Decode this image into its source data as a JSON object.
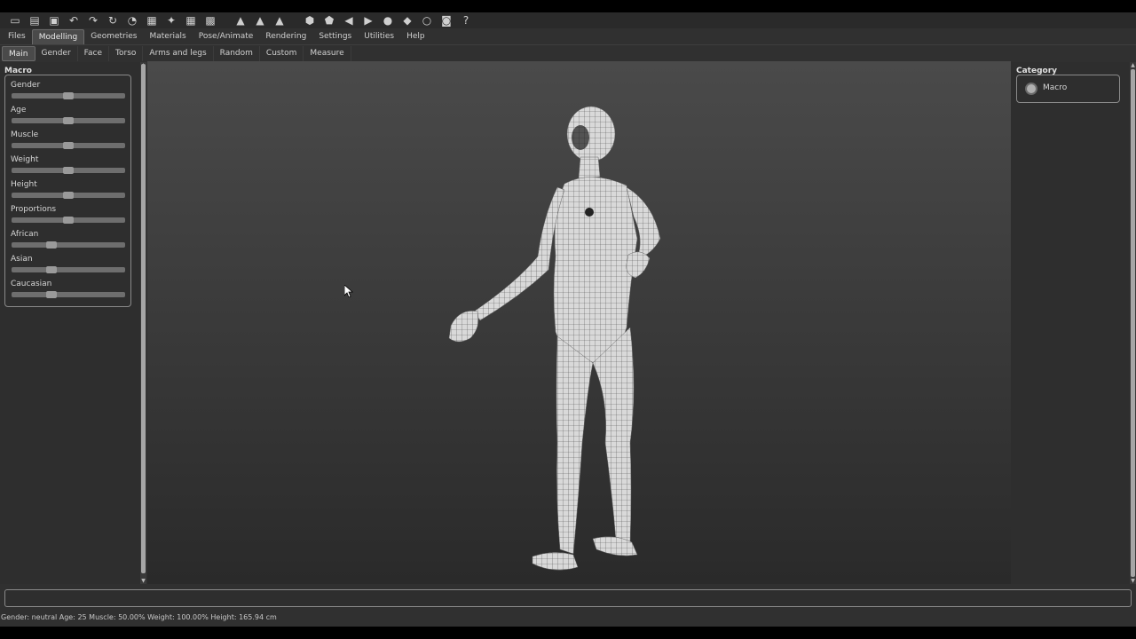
{
  "toolbar": {
    "icons": [
      "new-file-icon",
      "save-icon",
      "export-icon",
      "undo-icon",
      "redo-icon",
      "reset-icon",
      "smooth-icon",
      "wireframe-icon",
      "pose-icon",
      "grid-icon",
      "checker-icon",
      "front-view-icon",
      "side-view-icon",
      "top-view-icon",
      "shield-front-icon",
      "shield-back-icon",
      "shield-left-icon",
      "shield-right-icon",
      "sphere-icon",
      "shield-top-icon",
      "circle-icon",
      "camera-icon",
      "help-icon"
    ]
  },
  "menu_tabs": [
    "Files",
    "Modelling",
    "Geometries",
    "Materials",
    "Pose/Animate",
    "Rendering",
    "Settings",
    "Utilities",
    "Help"
  ],
  "active_menu_tab": "Modelling",
  "sub_tabs": [
    "Main",
    "Gender",
    "Face",
    "Torso",
    "Arms and legs",
    "Random",
    "Custom",
    "Measure"
  ],
  "active_sub_tab": "Main",
  "left_panel": {
    "title": "Macro",
    "sliders": [
      {
        "label": "Gender",
        "value": 0.5
      },
      {
        "label": "Age",
        "value": 0.5
      },
      {
        "label": "Muscle",
        "value": 0.5
      },
      {
        "label": "Weight",
        "value": 0.5
      },
      {
        "label": "Height",
        "value": 0.5
      },
      {
        "label": "Proportions",
        "value": 0.5
      },
      {
        "label": "African",
        "value": 0.333
      },
      {
        "label": "Asian",
        "value": 0.333
      },
      {
        "label": "Caucasian",
        "value": 0.333
      }
    ]
  },
  "right_panel": {
    "title": "Category",
    "radio_label": "Macro"
  },
  "status_text": "Gender: neutral Age: 25 Muscle: 50.00% Weight: 100.00% Height: 165.94 cm",
  "colors": {
    "background": "#303030",
    "viewport_top": "#4a4a4a",
    "viewport_bottom": "#2a2a2a"
  }
}
